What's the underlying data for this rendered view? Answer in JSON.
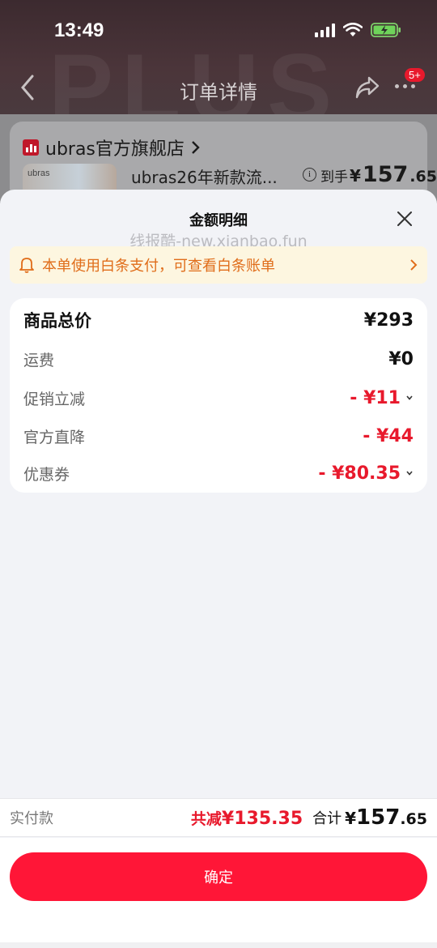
{
  "status_bar": {
    "time": "13:49"
  },
  "background_page": {
    "nav_title": "订单详情",
    "badge": "5+",
    "store_name": "ubras官方旗舰店",
    "thumb_text": "ubras",
    "product_name": "ubras26年新款流...",
    "price_prefix": "到手",
    "price_currency": "¥",
    "price_int": "157",
    "price_dec": ".65"
  },
  "sheet": {
    "title": "金额明细",
    "watermark": "线报酷-new.xianbao.fun",
    "notice": "本单使用白条支付，可查看白条账单",
    "rows": [
      {
        "label": "商品总价",
        "value": "¥293",
        "red": false
      },
      {
        "label": "运费",
        "value": "¥0",
        "red": false
      },
      {
        "label": "促销立减",
        "value": "- ¥11",
        "red": true,
        "expandable": true
      },
      {
        "label": "官方直降",
        "value": "- ¥44",
        "red": true
      },
      {
        "label": "优惠券",
        "value": "- ¥80.35",
        "red": true,
        "expandable": true
      }
    ]
  },
  "pay_bar": {
    "label": "实付款",
    "discount_label": "共减",
    "discount_value": "¥135.35",
    "total_label": "合计",
    "total_currency": "¥",
    "total_int": "157",
    "total_dec": ".65"
  },
  "confirm_label": "确定",
  "colors": {
    "accent_red": "#e8192c",
    "button_red": "#ff1637",
    "notice_orange": "#e06d1a"
  }
}
